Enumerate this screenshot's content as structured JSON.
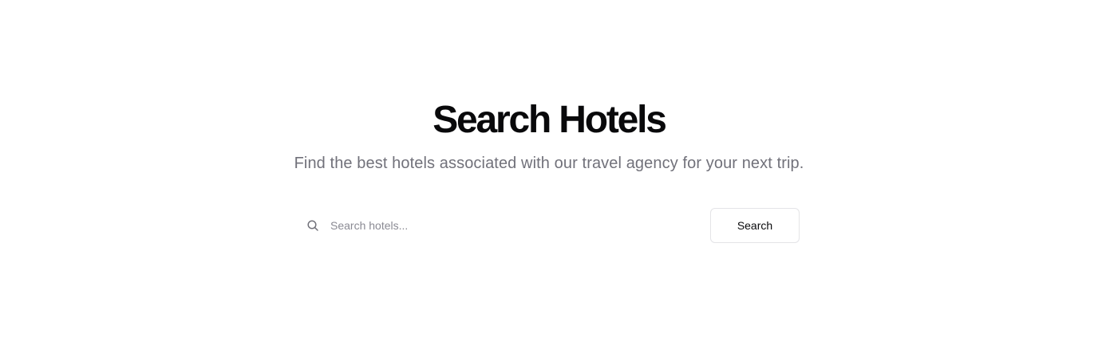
{
  "header": {
    "title": "Search Hotels",
    "subtitle": "Find the best hotels associated with our travel agency for your next trip."
  },
  "search": {
    "placeholder": "Search hotels...",
    "value": "",
    "button_label": "Search",
    "icon": "search-icon"
  },
  "colors": {
    "title": "#09090b",
    "subtitle": "#71717a",
    "placeholder": "#8a8a93",
    "button_border": "#e4e4e7",
    "background": "#ffffff"
  }
}
